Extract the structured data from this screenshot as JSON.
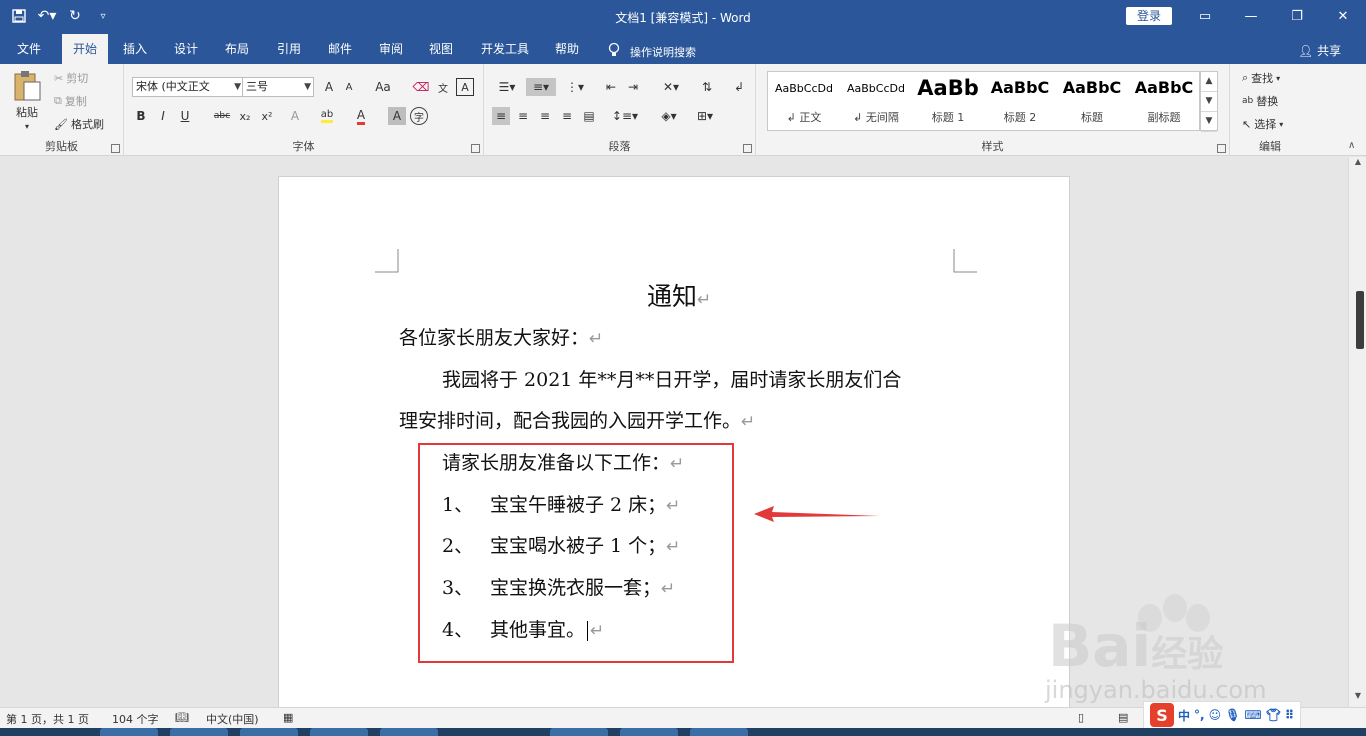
{
  "window": {
    "title": "文档1 [兼容模式] - Word",
    "login_label": "登录",
    "controls": [
      "▭",
      "—",
      "❐",
      "✕"
    ]
  },
  "tabs": [
    "文件",
    "开始",
    "插入",
    "设计",
    "布局",
    "引用",
    "邮件",
    "审阅",
    "视图",
    "开发工具",
    "帮助"
  ],
  "active_tab": "开始",
  "tell_me": "操作说明搜索",
  "share_label": "共享",
  "ribbon": {
    "clipboard": {
      "label": "剪贴板",
      "paste": "粘贴",
      "cut": "剪切",
      "copy": "复制",
      "format_painter": "格式刷"
    },
    "font": {
      "label": "字体",
      "font_name": "宋体 (中文正文",
      "font_size": "三号",
      "grow": "A",
      "shrink": "A",
      "case": "Aa",
      "bold": "B",
      "italic": "I",
      "underline": "U",
      "strike": "abc",
      "sub": "x₂",
      "sup": "x²"
    },
    "paragraph": {
      "label": "段落"
    },
    "styles": {
      "label": "样式",
      "items": [
        {
          "preview": "AaBbCcDd",
          "name": "↲ 正文"
        },
        {
          "preview": "AaBbCcDd",
          "name": "↲ 无间隔"
        },
        {
          "preview": "AaBb",
          "name": "标题 1"
        },
        {
          "preview": "AaBbC",
          "name": "标题 2"
        },
        {
          "preview": "AaBbC",
          "name": "标题"
        },
        {
          "preview": "AaBbC",
          "name": "副标题"
        }
      ]
    },
    "editing": {
      "label": "编辑",
      "find": "查找",
      "replace": "替换",
      "select": "选择"
    }
  },
  "document": {
    "title": "通知",
    "greeting": "各位家长朋友大家好：",
    "para1_line1": "我园将于 2021 年**月**日开学，届时请家长朋友们合",
    "para1_line2": "理安排时间，配合我园的入园开学工作。",
    "prep_heading": "请家长朋友准备以下工作：",
    "items": [
      {
        "num": "1、",
        "text": "宝宝午睡被子 2 床；"
      },
      {
        "num": "2、",
        "text": "宝宝喝水被子 1 个；"
      },
      {
        "num": "3、",
        "text": "宝宝换洗衣服一套；"
      },
      {
        "num": "4、",
        "text": "其他事宜。"
      }
    ],
    "paragraph_mark": "↵"
  },
  "status_bar": {
    "page": "第 1 页，共 1 页",
    "words": "104 个字",
    "language": "中文(中国)"
  },
  "ime": {
    "logo": "S",
    "mode": "中"
  },
  "watermark": {
    "brand": "Bai",
    "brand2": "经验",
    "url": "jingyan.baidu.com"
  },
  "colors": {
    "title_bar": "#2b579a",
    "annotation": "#e23a3a"
  }
}
